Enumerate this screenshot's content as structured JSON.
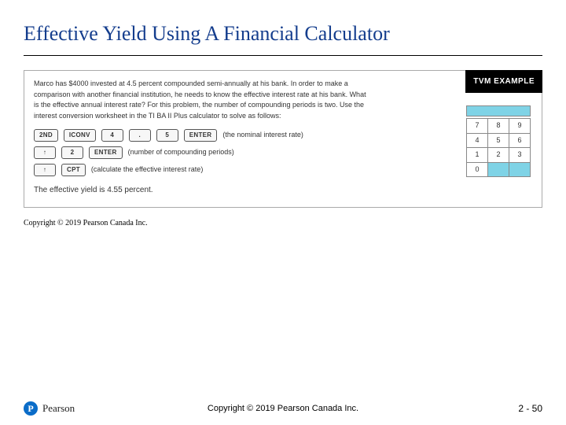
{
  "title": "Effective Yield Using A Financial Calculator",
  "tvm_label": "TVM EXAMPLE",
  "problem_text": "Marco has $4000 invested at 4.5 percent compounded semi-annually at his bank. In order to make a comparison with another financial institution, he needs to know the effective interest rate at his bank. What is the effective annual interest rate? For this problem, the number of compounding periods is two. Use the interest conversion worksheet in the TI BA II Plus calculator to solve as follows:",
  "seq1": {
    "keys": [
      "2ND",
      "ICONV",
      "4",
      ".",
      "5",
      "ENTER"
    ],
    "note": "(the nominal interest rate)"
  },
  "seq2": {
    "keys": [
      "↑",
      "2",
      "ENTER"
    ],
    "note": "(number of compounding periods)"
  },
  "seq3": {
    "keys": [
      "↑",
      "CPT"
    ],
    "note": "(calculate the effective interest rate)"
  },
  "result": "The effective yield is 4.55 percent.",
  "keypad_rows": [
    [
      "7",
      "8",
      "9"
    ],
    [
      "4",
      "5",
      "6"
    ],
    [
      "1",
      "2",
      "3"
    ],
    [
      "0",
      "",
      ""
    ]
  ],
  "inner_copyright": "Copyright © 2019 Pearson Canada Inc.",
  "footer_copyright": "Copyright © 2019 Pearson Canada Inc.",
  "brand_letter": "P",
  "brand_word": "Pearson",
  "page_number": "2 - 50"
}
